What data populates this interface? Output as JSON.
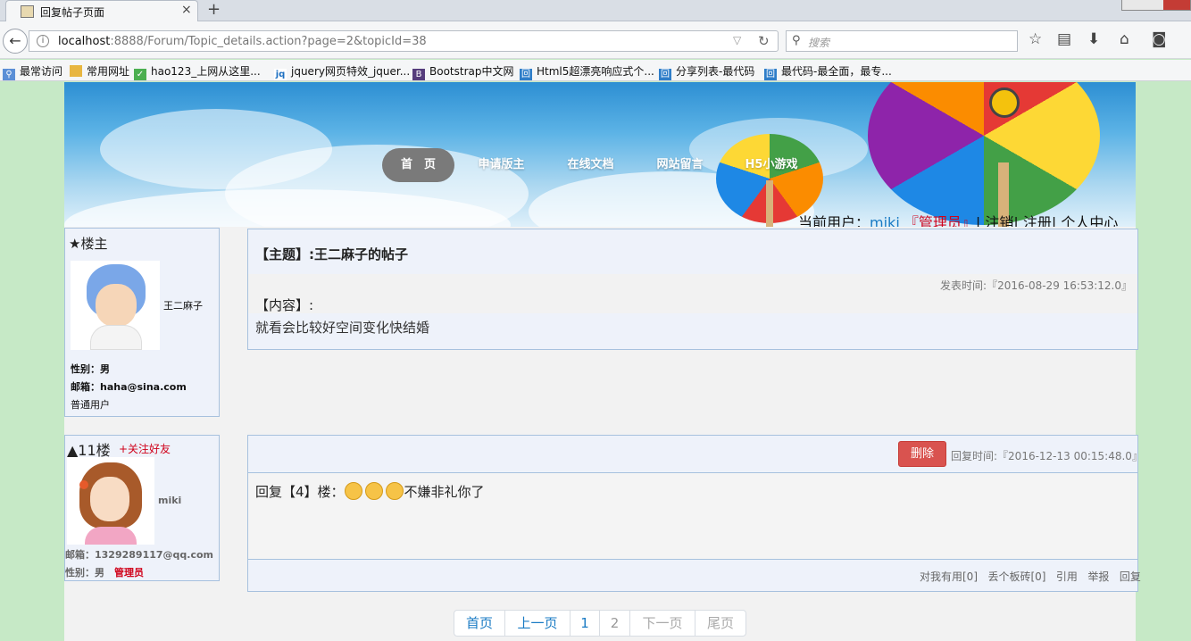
{
  "browser": {
    "tab_title": "回复帖子页面",
    "tab_close": "×",
    "new_tab": "+",
    "url_host": "localhost",
    "url_rest": ":8888/Forum/Topic_details.action?page=2&topicId=38",
    "search_placeholder": "搜索",
    "bookmarks": [
      "最常访问",
      "常用网址",
      "hao123_上网从这里...",
      "jquery网页特效_jquer...",
      "Bootstrap中文网",
      "Html5超漂亮响应式个...",
      "分享列表-最代码",
      "最代码-最全面，最专..."
    ]
  },
  "nav": {
    "home": "首　页",
    "apply": "申请版主",
    "docs": "在线文档",
    "message": "网站留言",
    "games": "H5小游戏"
  },
  "userbar": {
    "prefix": "当前用户：",
    "username": "miki",
    "role_open": " 『",
    "role": "管理员",
    "role_close": "』",
    "links": "| 注销| 注册| 个人中心"
  },
  "topic_author": {
    "label": "★楼主",
    "name": "王二麻子",
    "gender": "性别：男",
    "email": "邮箱：haha@sina.com",
    "level": "普通用户"
  },
  "topic": {
    "title": "【主题】:王二麻子的帖子",
    "time": "发表时间:『2016-08-29 16:53:12.0』",
    "content_label": "【内容】:",
    "content": "就看会比较好空间变化快结婚"
  },
  "reply_author": {
    "floor": "▲11楼",
    "follow": "+关注好友",
    "name": "miki",
    "email": "邮箱：1329289117@qq.com",
    "gender": "性别：男",
    "role": "管理员"
  },
  "reply": {
    "delete_label": "删除",
    "time": "回复时间:『2016-12-13 00:15:48.0』",
    "text_prefix": "回复【4】楼：",
    "text_suffix": "不嫌非礼你了",
    "actions": [
      "对我有用[0]",
      "丢个板砖[0]",
      "引用",
      "举报",
      "回复"
    ]
  },
  "pagination": {
    "first": "首页",
    "prev": "上一页",
    "p1": "1",
    "p2": "2",
    "next": "下一页",
    "last": "尾页"
  },
  "colors": {
    "page_bg": "#c6e9c6",
    "link_blue": "#1a7bc4",
    "admin_red": "#d0021b",
    "delete_red": "#d9534f"
  }
}
